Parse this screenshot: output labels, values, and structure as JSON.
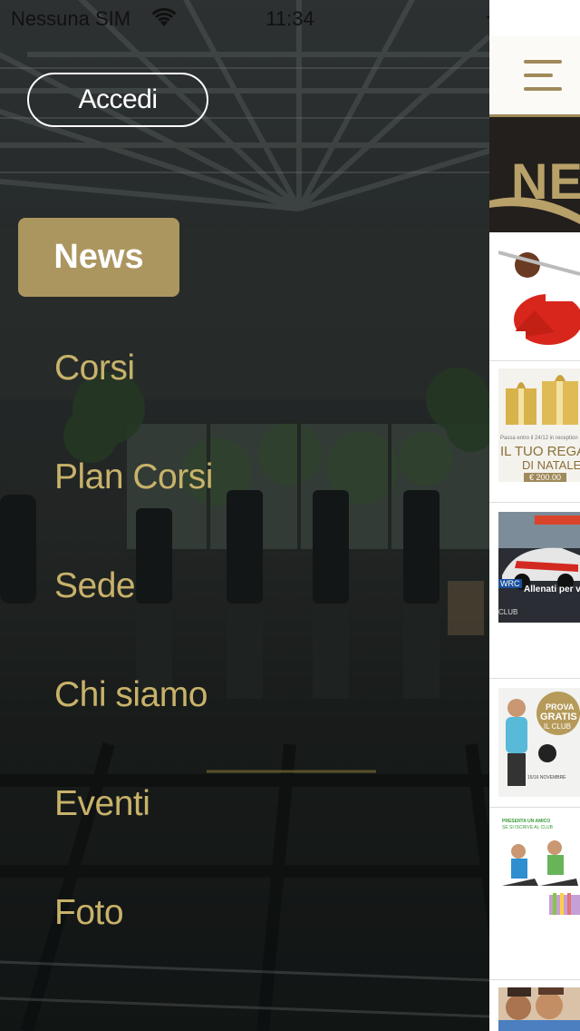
{
  "status_bar": {
    "carrier": "Nessuna SIM",
    "time": "11:34",
    "wifi_icon": "wifi-icon",
    "location_icon": "location-arrow-icon",
    "battery_icon": "battery-icon",
    "charging_icon": "charging-bolt-icon",
    "battery_color": "#4cd964"
  },
  "menu": {
    "login_label": "Accedi",
    "items": [
      {
        "label": "News",
        "active": true
      },
      {
        "label": "Corsi",
        "active": false
      },
      {
        "label": "Plan Corsi",
        "active": false
      },
      {
        "label": "Sede",
        "active": false
      },
      {
        "label": "Chi siamo",
        "active": false
      },
      {
        "label": "Eventi",
        "active": false
      },
      {
        "label": "Foto",
        "active": false
      }
    ],
    "accent_color": "#ac9660",
    "text_color": "#c8b26a"
  },
  "content": {
    "menu_icon": "hamburger-icon",
    "banner_title": "NE",
    "news_items": [
      {
        "thumb_icon": "santa-claus-lifting-image"
      },
      {
        "thumb_icon": "gift-boxes-image",
        "line1": "Passa entro il 24/12 in reception",
        "line2": "IL TUO REGA",
        "line3": "DI NATALE",
        "price": "€ 200.00"
      },
      {
        "thumb_icon": "rally-car-image",
        "line1": "Allenati per v",
        "line2": "WRC",
        "line3": "CLUB"
      },
      {
        "thumb_icon": "prova-gratis-image",
        "line1": "PROVA",
        "line2": "GRATIS",
        "line3": "IL CLUB",
        "line4": "15/16 NOVEMBRE"
      },
      {
        "thumb_icon": "fitness-couple-image",
        "line1": "PRESENTA UN AMICO",
        "line2": "SE SI ISCRIVE AL CLUB"
      },
      {
        "thumb_icon": "people-photo-image"
      }
    ]
  }
}
